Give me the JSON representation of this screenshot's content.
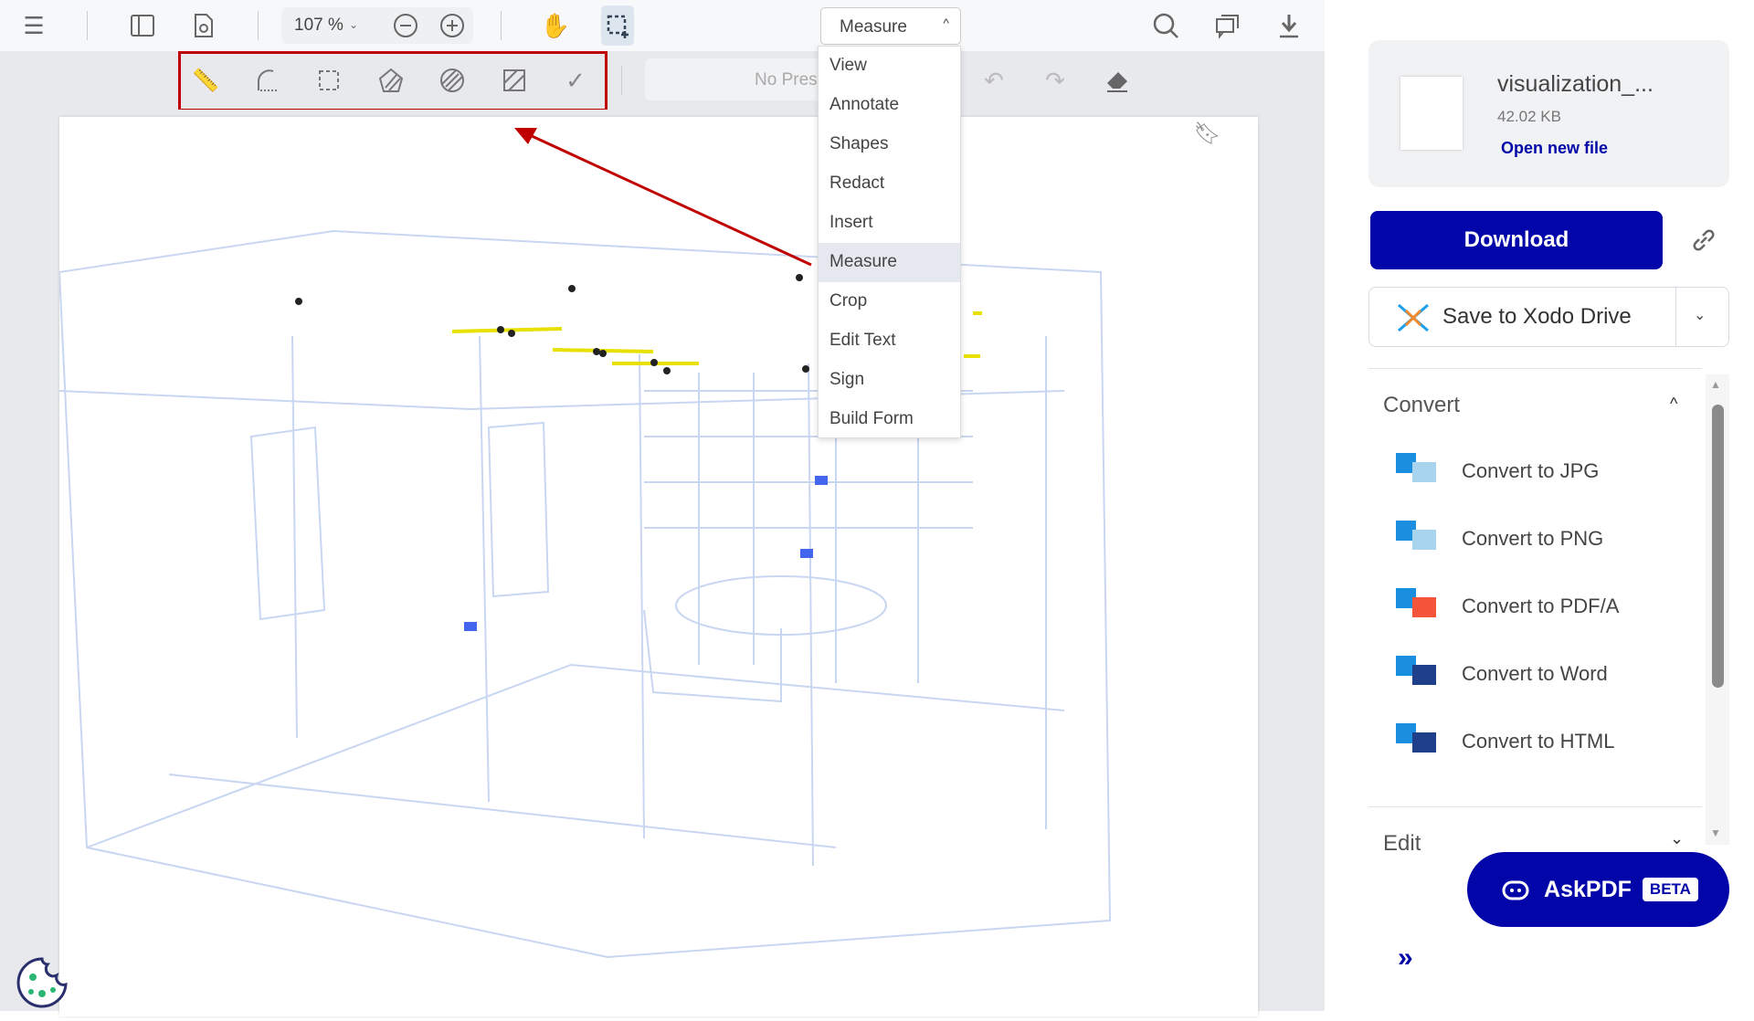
{
  "toolbar": {
    "zoom": "107 %",
    "mode": "Measure",
    "preset_placeholder": "No Presets"
  },
  "mode_menu": {
    "items": [
      "View",
      "Annotate",
      "Shapes",
      "Redact",
      "Insert",
      "Measure",
      "Crop",
      "Edit Text",
      "Sign",
      "Build Form"
    ],
    "selected": "Measure"
  },
  "file": {
    "name": "visualization_...",
    "size": "42.02 KB",
    "open_new": "Open new file"
  },
  "actions": {
    "download": "Download",
    "save_drive": "Save to Xodo Drive"
  },
  "convert": {
    "title": "Convert",
    "items": [
      "Convert to JPG",
      "Convert to PNG",
      "Convert to PDF/A",
      "Convert to Word",
      "Convert to HTML"
    ]
  },
  "edit": {
    "title": "Edit"
  },
  "askpdf": {
    "label": "AskPDF",
    "badge": "BETA"
  },
  "colors": {
    "brand": "#0206a8",
    "highlight": "#c00000"
  }
}
